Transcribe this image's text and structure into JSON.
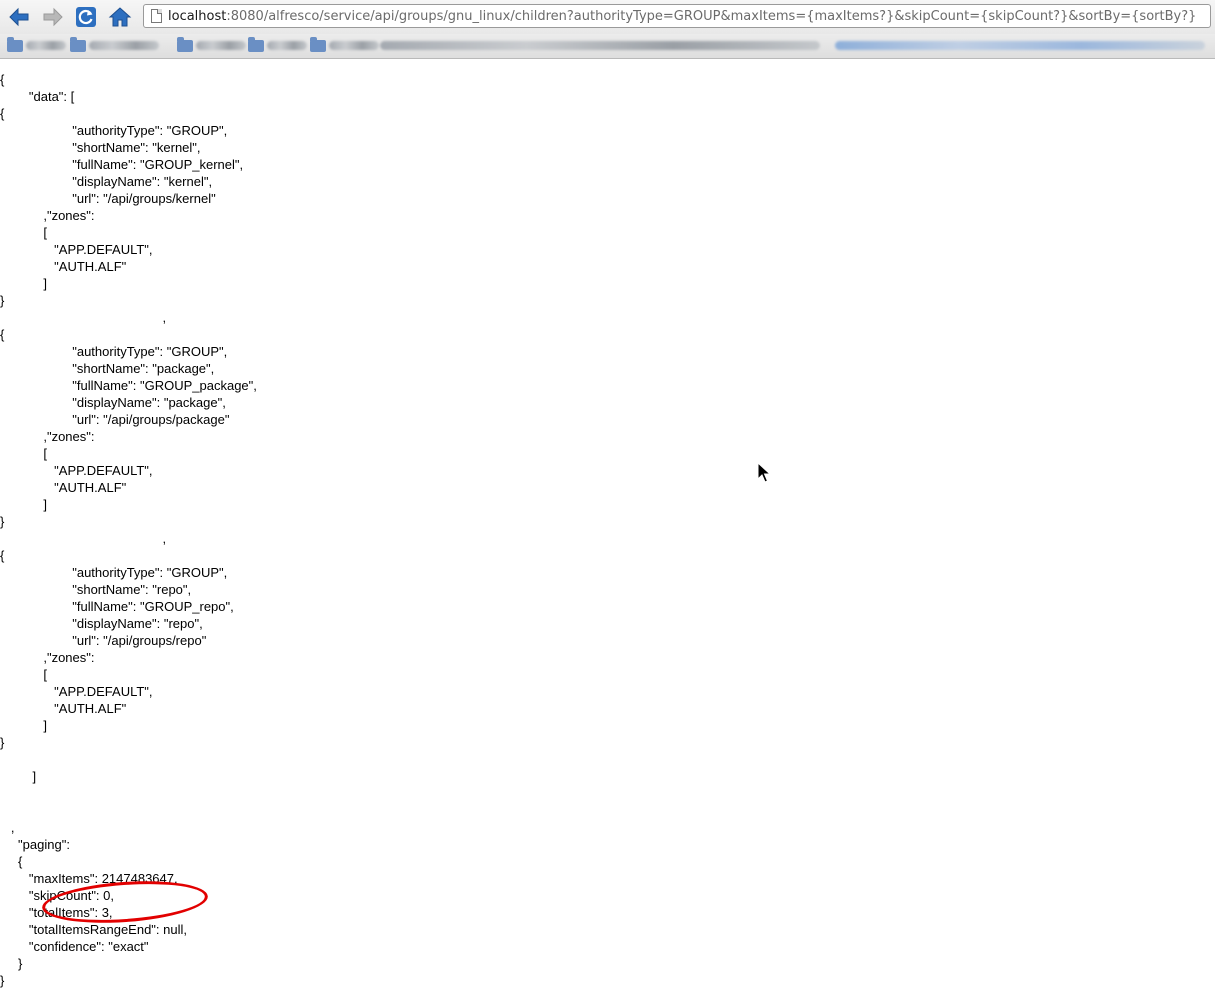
{
  "browser": {
    "url_host": "localhost",
    "url_rest": ":8080/alfresco/service/api/groups/gnu_linux/children?authorityType=GROUP&maxItems={maxItems?}&skipCount={skipCount?}&sortBy={sortBy?}"
  },
  "colors": {
    "accent": "#2d6fc0",
    "highlight": "#e20000"
  },
  "json_lines": [
    "{",
    "        \"data\": [",
    "{",
    "                    \"authorityType\": \"GROUP\",",
    "                    \"shortName\": \"kernel\",",
    "                    \"fullName\": \"GROUP_kernel\",",
    "                    \"displayName\": \"kernel\",",
    "                    \"url\": \"/api/groups/kernel\"",
    "            ,\"zones\":",
    "            [",
    "               \"APP.DEFAULT\",",
    "               \"AUTH.ALF\"",
    "            ]",
    "}",
    "                                             ,",
    "{",
    "                    \"authorityType\": \"GROUP\",",
    "                    \"shortName\": \"package\",",
    "                    \"fullName\": \"GROUP_package\",",
    "                    \"displayName\": \"package\",",
    "                    \"url\": \"/api/groups/package\"",
    "            ,\"zones\":",
    "            [",
    "               \"APP.DEFAULT\",",
    "               \"AUTH.ALF\"",
    "            ]",
    "}",
    "                                             ,",
    "{",
    "                    \"authorityType\": \"GROUP\",",
    "                    \"shortName\": \"repo\",",
    "                    \"fullName\": \"GROUP_repo\",",
    "                    \"displayName\": \"repo\",",
    "                    \"url\": \"/api/groups/repo\"",
    "            ,\"zones\":",
    "            [",
    "               \"APP.DEFAULT\",",
    "               \"AUTH.ALF\"",
    "            ]",
    "}",
    "",
    "         ]",
    "",
    "",
    "   ,",
    "     \"paging\":",
    "     {",
    "        \"maxItems\": 2147483647,",
    "        \"skipCount\": 0,",
    "        \"totalItems\": 3,",
    "        \"totalItemsRangeEnd\": null,",
    "        \"confidence\": \"exact\"",
    "     }",
    "}"
  ]
}
